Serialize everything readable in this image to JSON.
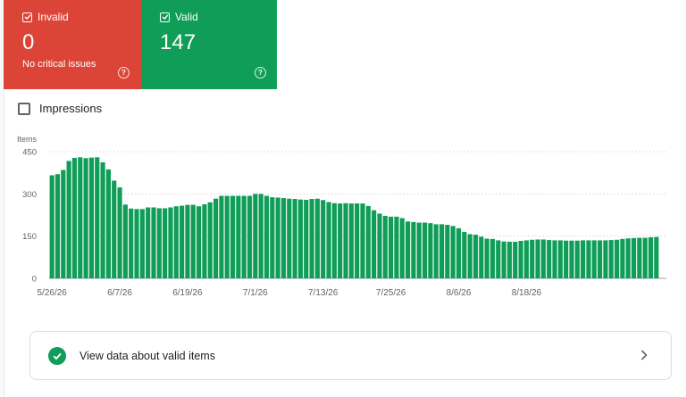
{
  "cards": {
    "invalid": {
      "label": "Invalid",
      "count": "0",
      "subtitle": "No critical issues",
      "color": "#db4437"
    },
    "valid": {
      "label": "Valid",
      "count": "147",
      "color": "#0f9d58"
    }
  },
  "impressions_label": "Impressions",
  "view_link_label": "View data about valid items",
  "chart_data": {
    "type": "bar",
    "ylabel": "Items",
    "ylim": [
      0,
      450
    ],
    "yticks": [
      0,
      150,
      300,
      450
    ],
    "xtick_labels": [
      "5/26/26",
      "6/7/26",
      "6/19/26",
      "7/1/26",
      "7/13/26",
      "7/25/26",
      "8/6/26",
      "8/18/26"
    ],
    "bar_color": "#0f9d58",
    "grid": true,
    "values": [
      366,
      370,
      385,
      417,
      428,
      430,
      427,
      429,
      430,
      412,
      387,
      347,
      323,
      262,
      248,
      246,
      246,
      252,
      252,
      249,
      249,
      252,
      256,
      258,
      261,
      261,
      256,
      263,
      270,
      283,
      293,
      293,
      293,
      293,
      293,
      293,
      300,
      300,
      293,
      288,
      287,
      285,
      283,
      282,
      280,
      279,
      282,
      283,
      278,
      271,
      267,
      266,
      267,
      266,
      266,
      266,
      257,
      242,
      230,
      222,
      219,
      219,
      214,
      202,
      200,
      198,
      198,
      196,
      192,
      192,
      190,
      186,
      178,
      165,
      157,
      155,
      148,
      141,
      140,
      135,
      131,
      130,
      130,
      133,
      135,
      137,
      138,
      138,
      136,
      135,
      135,
      134,
      134,
      134,
      135,
      135,
      135,
      135,
      135,
      136,
      137,
      140,
      142,
      143,
      144,
      144,
      146,
      147
    ]
  }
}
